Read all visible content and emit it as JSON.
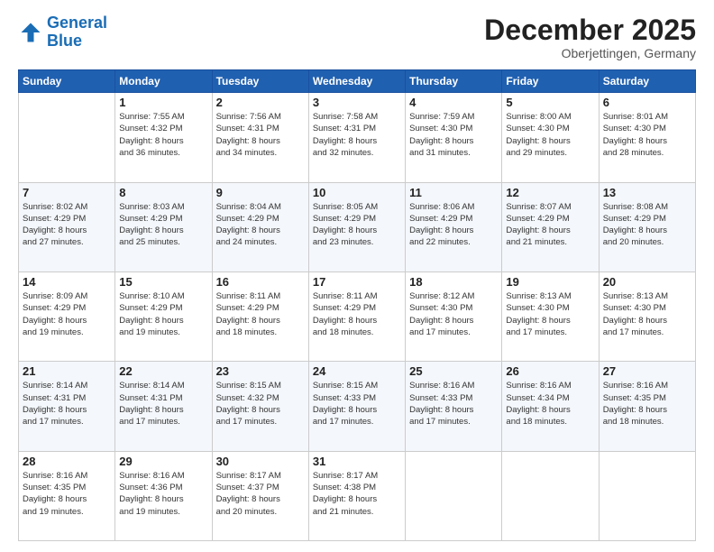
{
  "header": {
    "logo_line1": "General",
    "logo_line2": "Blue",
    "month": "December 2025",
    "location": "Oberjettingen, Germany"
  },
  "weekdays": [
    "Sunday",
    "Monday",
    "Tuesday",
    "Wednesday",
    "Thursday",
    "Friday",
    "Saturday"
  ],
  "weeks": [
    [
      {
        "day": "",
        "info": ""
      },
      {
        "day": "1",
        "info": "Sunrise: 7:55 AM\nSunset: 4:32 PM\nDaylight: 8 hours\nand 36 minutes."
      },
      {
        "day": "2",
        "info": "Sunrise: 7:56 AM\nSunset: 4:31 PM\nDaylight: 8 hours\nand 34 minutes."
      },
      {
        "day": "3",
        "info": "Sunrise: 7:58 AM\nSunset: 4:31 PM\nDaylight: 8 hours\nand 32 minutes."
      },
      {
        "day": "4",
        "info": "Sunrise: 7:59 AM\nSunset: 4:30 PM\nDaylight: 8 hours\nand 31 minutes."
      },
      {
        "day": "5",
        "info": "Sunrise: 8:00 AM\nSunset: 4:30 PM\nDaylight: 8 hours\nand 29 minutes."
      },
      {
        "day": "6",
        "info": "Sunrise: 8:01 AM\nSunset: 4:30 PM\nDaylight: 8 hours\nand 28 minutes."
      }
    ],
    [
      {
        "day": "7",
        "info": "Sunrise: 8:02 AM\nSunset: 4:29 PM\nDaylight: 8 hours\nand 27 minutes."
      },
      {
        "day": "8",
        "info": "Sunrise: 8:03 AM\nSunset: 4:29 PM\nDaylight: 8 hours\nand 25 minutes."
      },
      {
        "day": "9",
        "info": "Sunrise: 8:04 AM\nSunset: 4:29 PM\nDaylight: 8 hours\nand 24 minutes."
      },
      {
        "day": "10",
        "info": "Sunrise: 8:05 AM\nSunset: 4:29 PM\nDaylight: 8 hours\nand 23 minutes."
      },
      {
        "day": "11",
        "info": "Sunrise: 8:06 AM\nSunset: 4:29 PM\nDaylight: 8 hours\nand 22 minutes."
      },
      {
        "day": "12",
        "info": "Sunrise: 8:07 AM\nSunset: 4:29 PM\nDaylight: 8 hours\nand 21 minutes."
      },
      {
        "day": "13",
        "info": "Sunrise: 8:08 AM\nSunset: 4:29 PM\nDaylight: 8 hours\nand 20 minutes."
      }
    ],
    [
      {
        "day": "14",
        "info": "Sunrise: 8:09 AM\nSunset: 4:29 PM\nDaylight: 8 hours\nand 19 minutes."
      },
      {
        "day": "15",
        "info": "Sunrise: 8:10 AM\nSunset: 4:29 PM\nDaylight: 8 hours\nand 19 minutes."
      },
      {
        "day": "16",
        "info": "Sunrise: 8:11 AM\nSunset: 4:29 PM\nDaylight: 8 hours\nand 18 minutes."
      },
      {
        "day": "17",
        "info": "Sunrise: 8:11 AM\nSunset: 4:29 PM\nDaylight: 8 hours\nand 18 minutes."
      },
      {
        "day": "18",
        "info": "Sunrise: 8:12 AM\nSunset: 4:30 PM\nDaylight: 8 hours\nand 17 minutes."
      },
      {
        "day": "19",
        "info": "Sunrise: 8:13 AM\nSunset: 4:30 PM\nDaylight: 8 hours\nand 17 minutes."
      },
      {
        "day": "20",
        "info": "Sunrise: 8:13 AM\nSunset: 4:30 PM\nDaylight: 8 hours\nand 17 minutes."
      }
    ],
    [
      {
        "day": "21",
        "info": "Sunrise: 8:14 AM\nSunset: 4:31 PM\nDaylight: 8 hours\nand 17 minutes."
      },
      {
        "day": "22",
        "info": "Sunrise: 8:14 AM\nSunset: 4:31 PM\nDaylight: 8 hours\nand 17 minutes."
      },
      {
        "day": "23",
        "info": "Sunrise: 8:15 AM\nSunset: 4:32 PM\nDaylight: 8 hours\nand 17 minutes."
      },
      {
        "day": "24",
        "info": "Sunrise: 8:15 AM\nSunset: 4:33 PM\nDaylight: 8 hours\nand 17 minutes."
      },
      {
        "day": "25",
        "info": "Sunrise: 8:16 AM\nSunset: 4:33 PM\nDaylight: 8 hours\nand 17 minutes."
      },
      {
        "day": "26",
        "info": "Sunrise: 8:16 AM\nSunset: 4:34 PM\nDaylight: 8 hours\nand 18 minutes."
      },
      {
        "day": "27",
        "info": "Sunrise: 8:16 AM\nSunset: 4:35 PM\nDaylight: 8 hours\nand 18 minutes."
      }
    ],
    [
      {
        "day": "28",
        "info": "Sunrise: 8:16 AM\nSunset: 4:35 PM\nDaylight: 8 hours\nand 19 minutes."
      },
      {
        "day": "29",
        "info": "Sunrise: 8:16 AM\nSunset: 4:36 PM\nDaylight: 8 hours\nand 19 minutes."
      },
      {
        "day": "30",
        "info": "Sunrise: 8:17 AM\nSunset: 4:37 PM\nDaylight: 8 hours\nand 20 minutes."
      },
      {
        "day": "31",
        "info": "Sunrise: 8:17 AM\nSunset: 4:38 PM\nDaylight: 8 hours\nand 21 minutes."
      },
      {
        "day": "",
        "info": ""
      },
      {
        "day": "",
        "info": ""
      },
      {
        "day": "",
        "info": ""
      }
    ]
  ]
}
